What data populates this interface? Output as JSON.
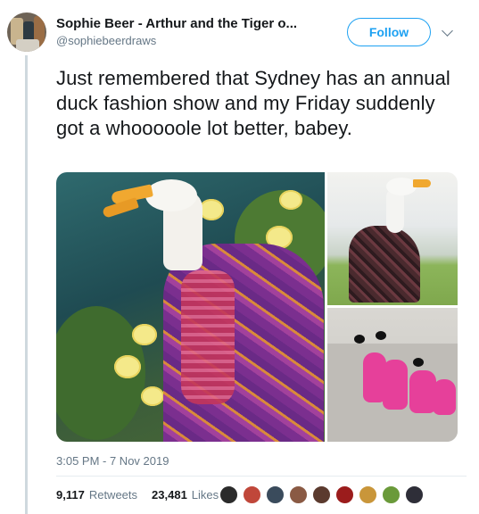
{
  "author": {
    "display_name": "Sophie Beer - Arthur and the Tiger o...",
    "handle": "@sophiebeerdraws"
  },
  "actions": {
    "follow_label": "Follow"
  },
  "tweet": {
    "text": "Just remembered that Sydney has an annual duck fashion show and my Friday suddenly got a whooooole lot better, babey.",
    "timestamp": "3:05 PM - 7 Nov 2019"
  },
  "stats": {
    "retweets_count": "9,117",
    "retweets_label": "Retweets",
    "likes_count": "23,481",
    "likes_label": "Likes"
  },
  "likers": [
    {
      "name": "liker-avatar-1",
      "color": "#2b2b2b"
    },
    {
      "name": "liker-avatar-2",
      "color": "#c0473a"
    },
    {
      "name": "liker-avatar-3",
      "color": "#3a4b5c"
    },
    {
      "name": "liker-avatar-4",
      "color": "#8a5a44"
    },
    {
      "name": "liker-avatar-5",
      "color": "#5b3a2e"
    },
    {
      "name": "liker-avatar-6",
      "color": "#9b1c1c"
    },
    {
      "name": "liker-avatar-7",
      "color": "#c9963a"
    },
    {
      "name": "liker-avatar-8",
      "color": "#6a9a3a"
    },
    {
      "name": "liker-avatar-9",
      "color": "#2e2e38"
    }
  ],
  "colors": {
    "accent": "#1da1f2",
    "secondary_text": "#657786",
    "primary_text": "#14171a"
  },
  "icons": {
    "caret": "chevron-down-icon"
  }
}
